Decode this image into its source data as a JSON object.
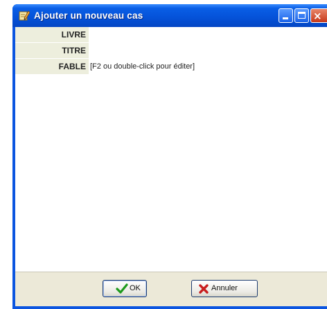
{
  "window": {
    "title": "Ajouter un nouveau cas",
    "icons": {
      "app": "edit-pencil-icon",
      "minimize": "minimize-icon",
      "maximize": "maximize-icon",
      "close": "close-icon"
    },
    "close_glyph": "×"
  },
  "fields": [
    {
      "label": "LIVRE",
      "value": ""
    },
    {
      "label": "TITRE",
      "value": ""
    },
    {
      "label": "FABLE",
      "value": "[F2 ou double-click pour éditer]"
    }
  ],
  "buttons": {
    "ok_label": "OK",
    "ok_icon": "checkmark-icon",
    "cancel_label": "Annuler",
    "cancel_icon": "red-x-icon"
  },
  "colors": {
    "titlebar": "#0553da",
    "label_background": "#edeedd",
    "footer_background": "#ece9d8",
    "ok_check": "#1c9a1c",
    "cancel_x": "#c81e1e"
  }
}
